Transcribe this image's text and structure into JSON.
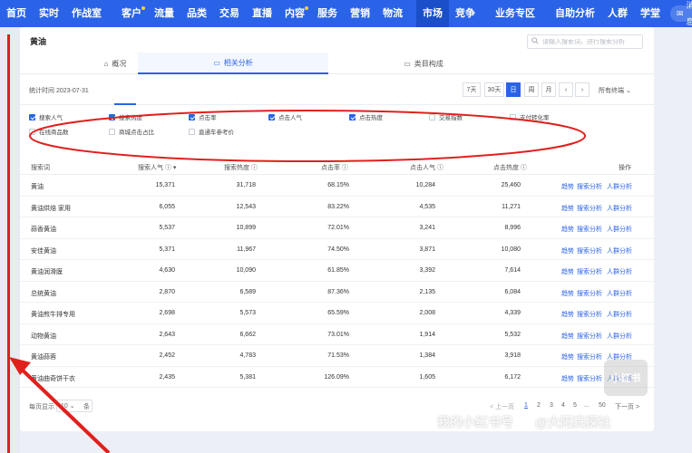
{
  "topnav": {
    "items": [
      {
        "label": "首页",
        "dot": false
      },
      {
        "label": "实时",
        "dot": false
      },
      {
        "label": "作战室",
        "dot": false
      },
      {
        "sep": true
      },
      {
        "label": "客户",
        "dot": true
      },
      {
        "label": "流量",
        "dot": false
      },
      {
        "label": "品类",
        "dot": false
      },
      {
        "label": "交易",
        "dot": false
      },
      {
        "label": "直播",
        "dot": false
      },
      {
        "label": "内容",
        "dot": true
      },
      {
        "label": "服务",
        "dot": false
      },
      {
        "label": "营销",
        "dot": false
      },
      {
        "label": "物流",
        "dot": false
      },
      {
        "sep": true
      },
      {
        "label": "市场",
        "dot": false,
        "active": true
      },
      {
        "label": "竞争",
        "dot": false
      },
      {
        "sep": true
      },
      {
        "label": "业务专区",
        "dot": false
      },
      {
        "sep": true
      },
      {
        "label": "自助分析",
        "dot": false
      },
      {
        "label": "人群",
        "dot": false
      },
      {
        "label": "学堂",
        "dot": false
      }
    ],
    "message": "消息"
  },
  "panel": {
    "title": "黄油",
    "search_placeholder": "请输入搜索词，进行搜索分析",
    "tabs": [
      "概况",
      "相关分析",
      "类目构成"
    ],
    "stat_time": "统计时间 2023-07-31",
    "periods": [
      "7天",
      "30天",
      "日",
      "周",
      "月"
    ],
    "terminal": "所有终端"
  },
  "checkboxes": [
    {
      "label": "搜索人气",
      "checked": true
    },
    {
      "label": "搜索热度",
      "checked": true
    },
    {
      "label": "点击率",
      "checked": true
    },
    {
      "label": "点击人气",
      "checked": true
    },
    {
      "label": "点击热度",
      "checked": true
    },
    {
      "label": "交易指数",
      "checked": false
    },
    {
      "label": "支付转化率",
      "checked": false
    },
    {
      "label": "在线商品数",
      "checked": false
    },
    {
      "label": "商城点击占比",
      "checked": false
    },
    {
      "label": "直通车参考价",
      "checked": false
    }
  ],
  "table": {
    "headers": [
      "搜索词",
      "搜索人气",
      "搜索热度",
      "点击率",
      "点击人气",
      "点击热度",
      "操作"
    ],
    "actions": [
      "趋势",
      "搜索分析",
      "人群分析"
    ],
    "rows": [
      [
        "黄油",
        "15,371",
        "31,718",
        "68.15%",
        "10,284",
        "25,460"
      ],
      [
        "黄油烘焙 家用",
        "6,055",
        "12,543",
        "83.22%",
        "4,535",
        "11,271"
      ],
      [
        "蒜香黄油",
        "5,537",
        "10,899",
        "72.01%",
        "3,241",
        "8,996"
      ],
      [
        "安佳黄油",
        "5,371",
        "11,967",
        "74.50%",
        "3,871",
        "10,080"
      ],
      [
        "黄油润滑膜",
        "4,630",
        "10,090",
        "61.85%",
        "3,392",
        "7,614"
      ],
      [
        "总统黄油",
        "2,870",
        "6,589",
        "87.36%",
        "2,135",
        "6,084"
      ],
      [
        "黄油煎牛排专用",
        "2,698",
        "5,573",
        "65.59%",
        "2,008",
        "4,339"
      ],
      [
        "动物黄油",
        "2,643",
        "6,662",
        "73.01%",
        "1,914",
        "5,532"
      ],
      [
        "黄油蒜蓉",
        "2,452",
        "4,783",
        "71.53%",
        "1,384",
        "3,918"
      ],
      [
        "黄油曲奇饼干衣",
        "2,435",
        "5,381",
        "126.09%",
        "1,605",
        "6,172"
      ]
    ]
  },
  "pager": {
    "per_page": "每页显示",
    "per_page_value": "10",
    "unit": "条",
    "prev": "< 上一页",
    "pages": [
      "1",
      "2",
      "3",
      "4",
      "5",
      "...",
      "50"
    ],
    "next": "下一页 >"
  },
  "watermark": {
    "text1": "我的小红书号",
    "text2": "@大阳真探社",
    "logo": "小红书"
  },
  "colors": {
    "nav": "#2a63e8",
    "annotation": "#e0201d"
  }
}
